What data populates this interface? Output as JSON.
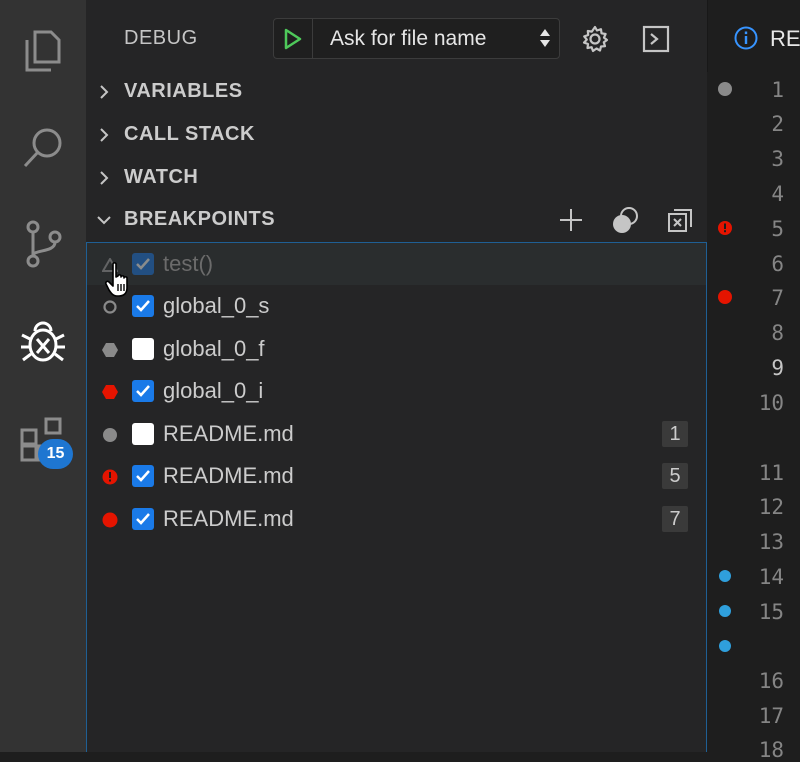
{
  "activity_badge": "15",
  "debug": {
    "title": "DEBUG",
    "launch_config": "Ask for file name"
  },
  "sections": {
    "variables": "VARIABLES",
    "call_stack": "CALL STACK",
    "watch": "WATCH",
    "breakpoints": "BREAKPOINTS"
  },
  "breakpoints": [
    {
      "name": "test()",
      "checked": true,
      "icon": "unverified-triangle-icon"
    },
    {
      "name": "global_0_s",
      "checked": true,
      "icon": "hollow-circle-icon"
    },
    {
      "name": "global_0_f",
      "checked": false,
      "icon": "grey-hexagon-icon"
    },
    {
      "name": "global_0_i",
      "checked": true,
      "icon": "red-hexagon-icon"
    },
    {
      "name": "README.md",
      "checked": false,
      "icon": "grey-dot-icon",
      "line": "1"
    },
    {
      "name": "README.md",
      "checked": true,
      "icon": "red-exclamation-dot-icon",
      "line": "5"
    },
    {
      "name": "README.md",
      "checked": true,
      "icon": "red-dot-icon",
      "line": "7"
    }
  ],
  "editor": {
    "tab_label": "RE",
    "line_numbers": [
      "1",
      "2",
      "3",
      "4",
      "5",
      "6",
      "7",
      "8",
      "9",
      "10",
      "11",
      "12",
      "13",
      "14",
      "15",
      "16",
      "17",
      "18"
    ],
    "current_line": "9"
  },
  "colors": {
    "accent": "#1a7ae8",
    "breakpoint_red": "#e51400",
    "log_blue": "#2f9fdc",
    "disabled_grey": "#8a8a8a"
  }
}
